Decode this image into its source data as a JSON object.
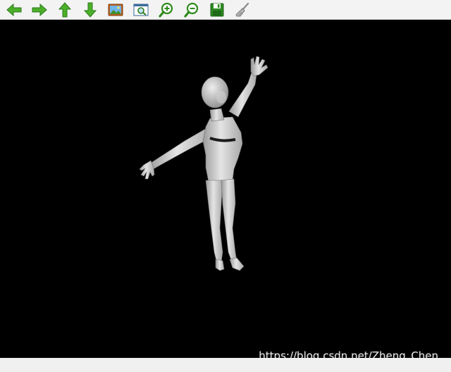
{
  "toolbar": {
    "buttons": [
      {
        "name": "back-button",
        "icon": "arrow-left-icon"
      },
      {
        "name": "forward-button",
        "icon": "arrow-right-icon"
      },
      {
        "name": "up-button",
        "icon": "arrow-up-icon"
      },
      {
        "name": "down-button",
        "icon": "arrow-down-icon"
      },
      {
        "name": "image-button",
        "icon": "picture-icon"
      },
      {
        "name": "view-button",
        "icon": "zoom-window-icon"
      },
      {
        "name": "zoom-in-button",
        "icon": "zoom-in-icon"
      },
      {
        "name": "zoom-out-button",
        "icon": "zoom-out-icon"
      },
      {
        "name": "save-button",
        "icon": "floppy-disk-icon"
      },
      {
        "name": "clear-button",
        "icon": "broom-icon"
      }
    ],
    "accent_color": "#3aa02c"
  },
  "viewport": {
    "background": "#000000",
    "model": "human-body-mesh",
    "watermark": "https://blog.csdn.net/Zheng_Chen"
  }
}
